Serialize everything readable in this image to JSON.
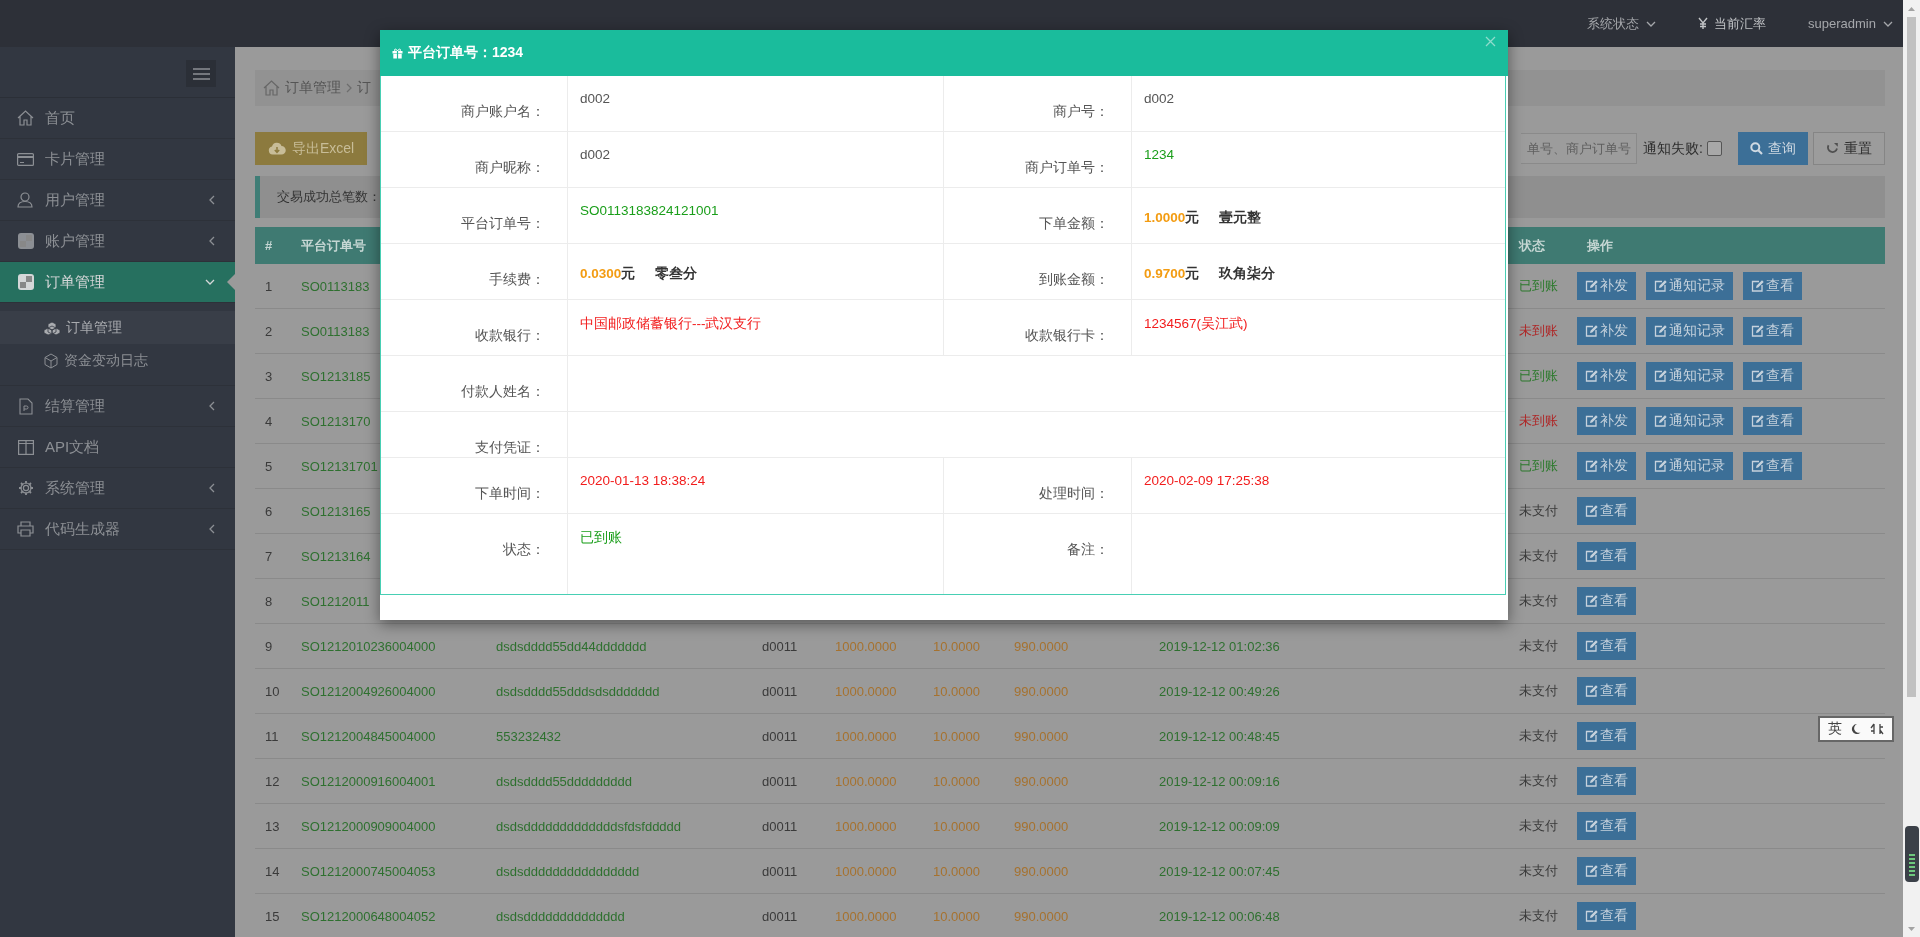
{
  "topbar": {
    "items": [
      {
        "label": "系统状态",
        "kind": "dropdown"
      },
      {
        "label": "当前汇率",
        "kind": "currency"
      },
      {
        "label": "superadmin",
        "kind": "dropdown"
      }
    ]
  },
  "sidebar": {
    "items": [
      {
        "label": "首页",
        "expandable": false,
        "selected": false
      },
      {
        "label": "卡片管理",
        "expandable": false,
        "selected": false
      },
      {
        "label": "用户管理",
        "expandable": true,
        "expanded": false,
        "selected": false
      },
      {
        "label": "账户管理",
        "expandable": true,
        "expanded": false,
        "selected": false
      },
      {
        "label": "订单管理",
        "expandable": true,
        "expanded": true,
        "selected": true,
        "children": [
          {
            "label": "订单管理",
            "selected": true
          },
          {
            "label": "资金变动日志",
            "selected": false
          }
        ]
      },
      {
        "label": "结算管理",
        "expandable": true,
        "expanded": false,
        "selected": false
      },
      {
        "label": "API文档",
        "expandable": false,
        "selected": false
      },
      {
        "label": "系统管理",
        "expandable": true,
        "expanded": false,
        "selected": false
      },
      {
        "label": "代码生成器",
        "expandable": true,
        "expanded": false,
        "selected": false
      }
    ]
  },
  "breadcrumb": [
    "订单管理",
    "订"
  ],
  "toolbar": {
    "export_label": "导出Excel",
    "search": {
      "placeholder": "单号、商户订单号"
    },
    "notify_failed": {
      "label": "通知失败:",
      "checked": false
    },
    "query_label": "查询",
    "reset_label": "重置"
  },
  "stats": {
    "label": "交易成功总笔数："
  },
  "table": {
    "columns": [
      "#",
      "平台订单号",
      "状态",
      "操作"
    ],
    "rows": [
      {
        "index": "1",
        "order_no": "SO0113183",
        "status": "已到账",
        "color": "#2d7a2d",
        "actions": [
          "补发",
          "通知记录",
          "查看"
        ]
      },
      {
        "index": "2",
        "order_no": "SO0113183",
        "status": "未到账",
        "color": "#ae2727",
        "actions": [
          "补发",
          "通知记录",
          "查看"
        ]
      },
      {
        "index": "3",
        "order_no": "SO1213185",
        "status": "已到账",
        "color": "#2d7a2d",
        "actions": [
          "补发",
          "通知记录",
          "查看"
        ]
      },
      {
        "index": "4",
        "order_no": "SO1213170",
        "status": "未到账",
        "color": "#ae2727",
        "actions": [
          "补发",
          "通知记录",
          "查看"
        ]
      },
      {
        "index": "5",
        "order_no": "SO12131701",
        "status": "已到账",
        "color": "#2d7a2d",
        "actions": [
          "补发",
          "通知记录",
          "查看"
        ]
      },
      {
        "index": "6",
        "order_no": "SO1213165",
        "status": "未支付",
        "color": "#3a3a3a",
        "actions": [
          "查看"
        ]
      },
      {
        "index": "7",
        "order_no": "SO1213164",
        "status": "未支付",
        "color": "#3a3a3a",
        "actions": [
          "查看"
        ]
      },
      {
        "index": "8",
        "order_no": "SO1212011",
        "status": "未支付",
        "color": "#3a3a3a",
        "actions": [
          "查看"
        ]
      },
      {
        "index": "9",
        "order_no": "SO1212010236004000",
        "merchant_order_no": "dsdsdddd55dd44ddddddd",
        "merchant": "d0011",
        "amount": "1000.0000",
        "fee": "10.0000",
        "net_amount": "990.0000",
        "time": "2019-12-12 01:02:36",
        "status": "未支付",
        "color": "#3a3a3a",
        "actions": [
          "查看"
        ]
      },
      {
        "index": "10",
        "order_no": "SO1212004926004000",
        "merchant_order_no": "dsdsdddd55dddsdsddddddd",
        "merchant": "d0011",
        "amount": "1000.0000",
        "fee": "10.0000",
        "net_amount": "990.0000",
        "time": "2019-12-12 00:49:26",
        "status": "未支付",
        "color": "#3a3a3a",
        "actions": [
          "查看"
        ]
      },
      {
        "index": "11",
        "order_no": "SO1212004845004000",
        "merchant_order_no": "553232432",
        "merchant": "d0011",
        "amount": "1000.0000",
        "fee": "10.0000",
        "net_amount": "990.0000",
        "time": "2019-12-12 00:48:45",
        "status": "未支付",
        "color": "#3a3a3a",
        "actions": [
          "查看"
        ]
      },
      {
        "index": "12",
        "order_no": "SO1212000916004001",
        "merchant_order_no": "dsdsdddd55ddddddddd",
        "merchant": "d0011",
        "amount": "1000.0000",
        "fee": "10.0000",
        "net_amount": "990.0000",
        "time": "2019-12-12 00:09:16",
        "status": "未支付",
        "color": "#3a3a3a",
        "actions": [
          "查看"
        ]
      },
      {
        "index": "13",
        "order_no": "SO1212000909004000",
        "merchant_order_no": "dsdsdddddddddddddsfdsfddddd",
        "merchant": "d0011",
        "amount": "1000.0000",
        "fee": "10.0000",
        "net_amount": "990.0000",
        "time": "2019-12-12 00:09:09",
        "status": "未支付",
        "color": "#3a3a3a",
        "actions": [
          "查看"
        ]
      },
      {
        "index": "14",
        "order_no": "SO1212000745004053",
        "merchant_order_no": "dsdsdddddddddddddddd",
        "merchant": "d0011",
        "amount": "1000.0000",
        "fee": "10.0000",
        "net_amount": "990.0000",
        "time": "2019-12-12 00:07:45",
        "status": "未支付",
        "color": "#3a3a3a",
        "actions": [
          "查看"
        ]
      },
      {
        "index": "15",
        "order_no": "SO1212000648004052",
        "merchant_order_no": "dsdsdddddddddddddd",
        "merchant": "d0011",
        "amount": "1000.0000",
        "fee": "10.0000",
        "net_amount": "990.0000",
        "time": "2019-12-12 00:06:48",
        "status": "未支付",
        "color": "#3a3a3a",
        "actions": [
          "查看"
        ]
      }
    ]
  },
  "modal": {
    "title": "平台订单号：1234",
    "rows": [
      {
        "cells": [
          {
            "kind": "text",
            "label": "商户账户名：",
            "value": "d002",
            "color": "#555555"
          },
          {
            "kind": "text",
            "label": "商户号：",
            "value": "d002",
            "color": "#555555"
          }
        ]
      },
      {
        "cells": [
          {
            "kind": "text",
            "label": "商户昵称：",
            "value": "d002",
            "color": "#555555"
          },
          {
            "kind": "text",
            "label": "商户订单号：",
            "value": "1234",
            "color": "#1a9e1a"
          }
        ]
      },
      {
        "cells": [
          {
            "kind": "text",
            "label": "平台订单号：",
            "value": "SO0113183824121001",
            "color": "#1a9e1a"
          },
          {
            "kind": "amount",
            "label": "下单金额：",
            "amount": "1.0000",
            "unit": "元",
            "words": "壹元整"
          }
        ]
      },
      {
        "cells": [
          {
            "kind": "amount",
            "label": "手续费：",
            "amount": "0.0300",
            "unit": "元",
            "words": "零叁分"
          },
          {
            "kind": "amount",
            "label": "到账金额：",
            "amount": "0.9700",
            "unit": "元",
            "words": "玖角柒分"
          }
        ]
      },
      {
        "cells": [
          {
            "kind": "text",
            "label": "收款银行：",
            "value": "中国邮政储蓄银行---武汉支行",
            "color": "#f21c1c"
          },
          {
            "kind": "text",
            "label": "收款银行卡：",
            "value": "1234567(吴江武)",
            "color": "#f21c1c"
          }
        ]
      },
      {
        "cells": [
          {
            "kind": "blank",
            "label": "付款人姓名："
          }
        ]
      },
      {
        "cells": [
          {
            "kind": "blank",
            "label": "支付凭证："
          }
        ]
      },
      {
        "cells": [
          {
            "kind": "text",
            "label": "下单时间：",
            "value": "2020-01-13 18:38:24",
            "color": "#f21c1c"
          },
          {
            "kind": "text",
            "label": "处理时间：",
            "value": "2020-02-09 17:25:38",
            "color": "#f21c1c"
          }
        ]
      },
      {
        "cells": [
          {
            "kind": "text",
            "label": "状态：",
            "value": "已到账",
            "color": "#1a9e1a"
          },
          {
            "kind": "blank",
            "label": "备注："
          }
        ]
      }
    ]
  },
  "ime_bar": {
    "mode": "英"
  }
}
